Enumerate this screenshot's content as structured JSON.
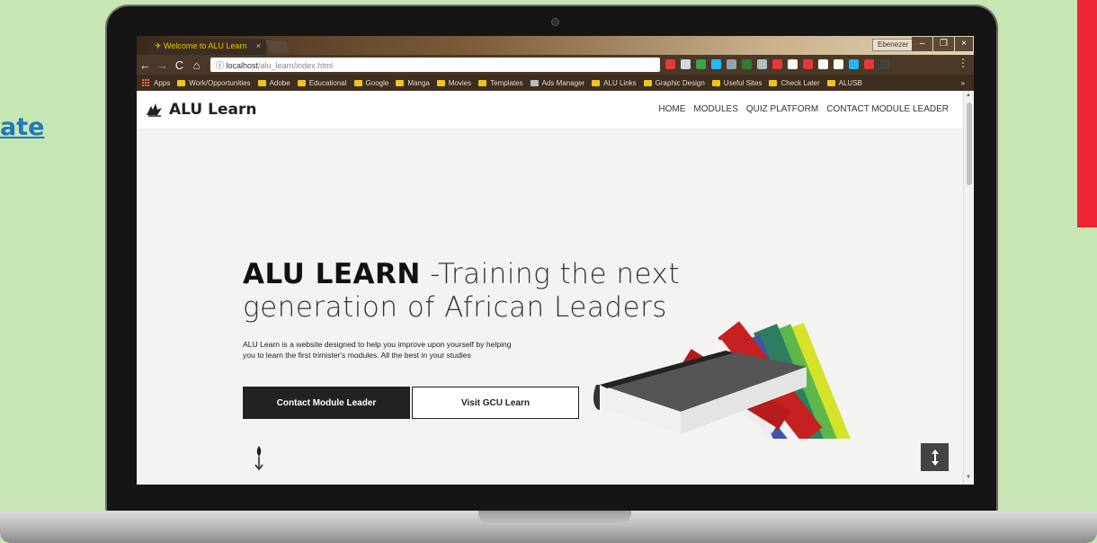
{
  "side_link": "ate",
  "browser": {
    "tab_title": "Welcome to ALU Learn",
    "tab_close": "×",
    "profile_name": "Ebenezer",
    "window_buttons": [
      "–",
      "❐",
      "×"
    ],
    "url_host": "localhost",
    "url_path": "/alu_learn/index.html",
    "nav_icons": [
      "←",
      "→",
      "C",
      "⌂"
    ],
    "bookmarks": [
      {
        "label": "Apps",
        "icon": "apps-grid-icon"
      },
      {
        "label": "Work/Opportunities",
        "icon": "folder-icon"
      },
      {
        "label": "Adobe",
        "icon": "folder-icon"
      },
      {
        "label": "Educational",
        "icon": "folder-icon"
      },
      {
        "label": "Google",
        "icon": "folder-icon"
      },
      {
        "label": "Manga",
        "icon": "folder-icon"
      },
      {
        "label": "Movies",
        "icon": "folder-icon"
      },
      {
        "label": "Templates",
        "icon": "folder-icon"
      },
      {
        "label": "Ads Manager",
        "icon": "page-icon"
      },
      {
        "label": "ALU Links",
        "icon": "folder-icon"
      },
      {
        "label": "Graphic Design",
        "icon": "folder-icon"
      },
      {
        "label": "Useful Sites",
        "icon": "folder-icon"
      },
      {
        "label": "Check Later",
        "icon": "folder-icon"
      },
      {
        "label": "ALUSB",
        "icon": "folder-icon"
      }
    ],
    "bookmarks_more": "»",
    "extension_colors": [
      "#e53935",
      "#cfd8dc",
      "#43a047",
      "#29b6f6",
      "#90a4ae",
      "#2e7d32",
      "#b0bec5",
      "#e53935",
      "#fafafa",
      "#e53935",
      "#fafafa",
      "#fafafa",
      "#29b6f6",
      "#e53935",
      "#424242"
    ]
  },
  "site": {
    "logo_text": "ALU Learn",
    "nav": [
      "HOME",
      "MODULES",
      "QUIZ PLATFORM",
      "CONTACT MODULE LEADER"
    ],
    "headline_bold": "ALU LEARN",
    "headline_light_1": " -Training the next",
    "headline_line2": "generation of African Leaders",
    "description": "ALU Learn is a website designed to help you improve upon yourself by helping you to learn the first trimister's modules. All the best in your studies",
    "btn_primary": "Contact Module Leader",
    "btn_secondary": "Visit GCU Learn"
  },
  "colors": {
    "background": "#c8e6b3",
    "accent_red": "#ec2434",
    "link_blue": "#1e79bf",
    "tab_text": "#f0c200",
    "button_dark": "#222222"
  }
}
